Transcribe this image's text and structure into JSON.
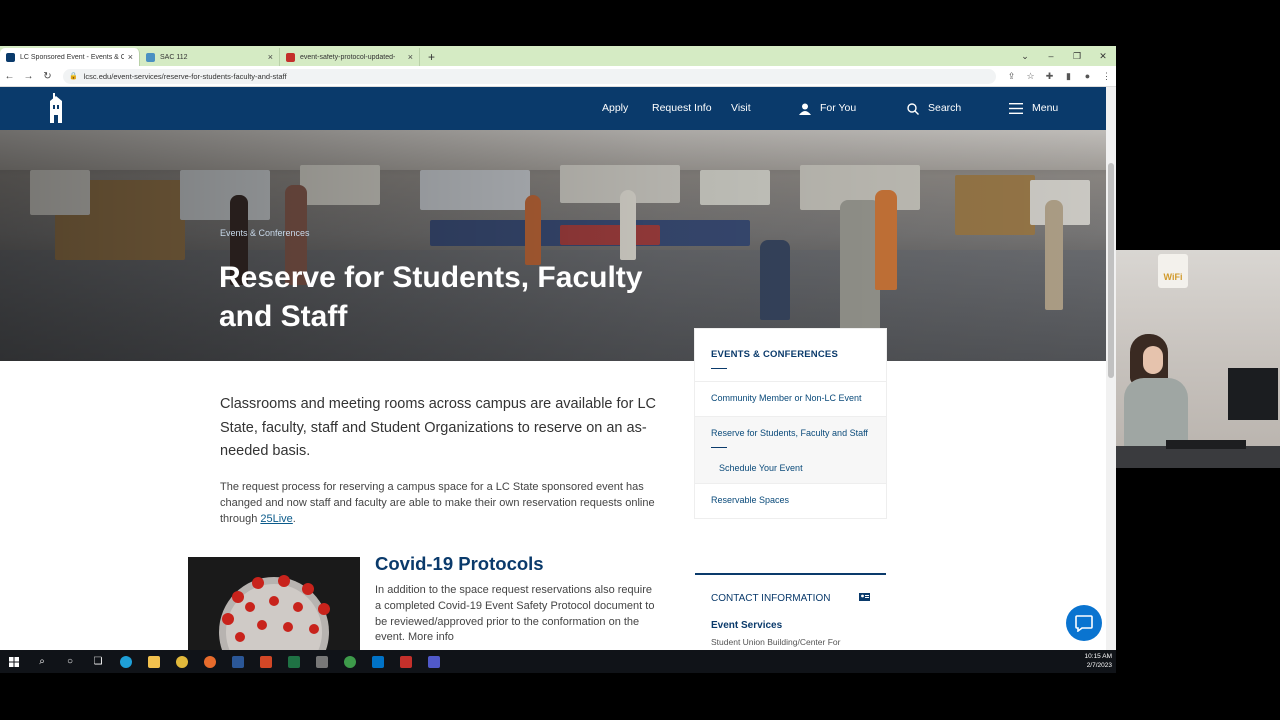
{
  "browser": {
    "tabs": [
      {
        "label": "LC Sponsored Event - Events & C",
        "active": true
      },
      {
        "label": "SAC 112",
        "active": false
      },
      {
        "label": "event-safety-protocol-updated-",
        "active": false
      }
    ],
    "new_tab": "+",
    "url": "lcsc.edu/event-services/reserve-for-students-faculty-and-staff"
  },
  "site_nav": {
    "links": [
      "Apply",
      "Request Info",
      "Visit"
    ],
    "for_you": "For You",
    "search": "Search",
    "menu": "Menu"
  },
  "hero": {
    "breadcrumb": "Events & Conferences",
    "title": "Reserve for Students, Faculty and Staff"
  },
  "main": {
    "intro": "Classrooms and meeting rooms across campus are available for LC State, faculty, staff and Student Organizations to reserve on an as-needed basis.",
    "para_before_link": "The request process for reserving a campus space for a LC State sponsored event has changed and now staff and faculty are able to make their own reservation requests online through ",
    "para_link": "25Live",
    "para_after_link": ".",
    "covid_heading": "Covid-19 Protocols",
    "covid_text": "In addition to the space request reservations also require a completed Covid-19 Event Safety Protocol document to be reviewed/approved prior to the conformation on the event. More info"
  },
  "sidenav": {
    "heading": "EVENTS & CONFERENCES",
    "items": [
      "Community Member or Non-LC Event",
      "Reserve for Students, Faculty and Staff",
      "Schedule Your Event",
      "Reservable Spaces"
    ]
  },
  "contact": {
    "heading": "CONTACT INFORMATION",
    "subheading": "Event Services",
    "address": "Student Union Building/Center For"
  },
  "taskbar": {
    "time": "10:15 AM",
    "date": "2/7/2023"
  },
  "colors": {
    "navy": "#0a3a6b",
    "tab_bar": "#d5ebc4",
    "chat": "#0a74d0"
  },
  "webcam": {
    "sign_text": "WiFi"
  }
}
